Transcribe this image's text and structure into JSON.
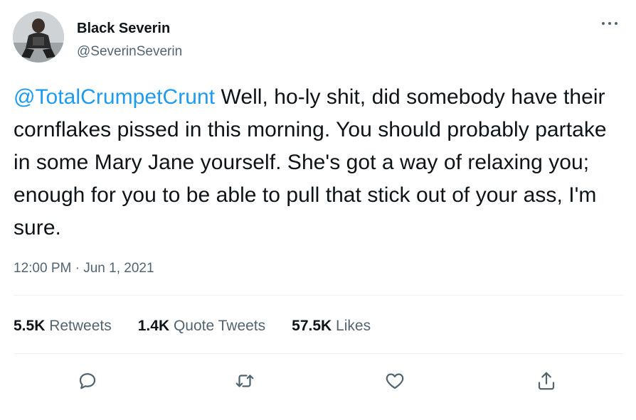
{
  "author": {
    "name": "Black Severin",
    "handle": "@SeverinSeverin"
  },
  "tweet": {
    "mention": "@TotalCrumpetCrunt",
    "body": " Well, ho-ly shit, did somebody have their cornflakes pissed in this morning. You should probably partake in some Mary Jane yourself. She's got a way of relaxing you; enough for you to be able to pull that stick out of your ass, I'm sure.",
    "timestamp": "12:00 PM · Jun 1, 2021"
  },
  "stats": [
    {
      "count": "5.5K",
      "label": "Retweets"
    },
    {
      "count": "1.4K",
      "label": "Quote Tweets"
    },
    {
      "count": "57.5K",
      "label": "Likes"
    }
  ],
  "actions": [
    "reply-icon",
    "retweet-icon",
    "like-icon",
    "share-icon"
  ],
  "colors": {
    "accent": "#1d9bf0",
    "secondary_text": "#536471",
    "divider": "#eff3f4"
  }
}
